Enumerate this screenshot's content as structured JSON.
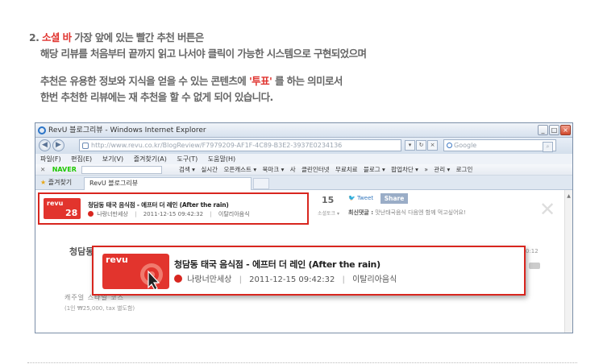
{
  "instruction": {
    "number": "2.",
    "highlight": "소셜 바",
    "line1_rest": "가장 앞에 있는 빨간 추천 버튼은",
    "line2": "해당 리뷰를 처음부터 끝까지 읽고 나서야 클릭이 가능한 시스템으로 구현되었으며",
    "line3_pre": "추천은 유용한 정보와 지식을 얻을 수 있는 콘텐츠에",
    "line3_quote": "'투표'",
    "line3_post": "를 하는 의미로서",
    "line4": "한번 추천한 리뷰에는 재 추천을 할 수 없게 되어 있습니다."
  },
  "browser": {
    "title": "RevU 블로그리뷰 - Windows Internet Explorer",
    "url": "http://www.revu.co.kr/BlogReview/F7979209-AF1F-4C89-B3E2-3937E0234136",
    "search_placeholder": "Google",
    "menu": [
      "파일(F)",
      "편집(E)",
      "보기(V)",
      "즐겨찾기(A)",
      "도구(T)",
      "도움말(H)"
    ],
    "toolbar_brand": "NAVER",
    "toolbar_items": [
      "검색 ▾",
      "실시간",
      "오픈캐스트 ▾",
      "북마크 ▾",
      "사",
      "클린인터넷",
      "무료치료",
      "블로그 ▾",
      "팝업차단 ▾",
      "»",
      "관리 ▾",
      "로그인"
    ],
    "favorites_label": "즐겨찾기",
    "tab_label": "RevU 블로그리뷰"
  },
  "social_bar": {
    "revu_label": "revu",
    "recommend_count": "28",
    "post_title": "청담동 태국 음식점 - 에프터 더 레인 (After the rain)",
    "author": "나랑너만세상",
    "date": "2011-12-15 09:42:32",
    "category": "이탈리아음식",
    "comment_count": "15",
    "comment_label": "소셜토크 ▾",
    "tweet_label": "Tweet",
    "share_label": "Share",
    "recent_label": "최신댓글 :",
    "recent_text": "맛난태국음식 다음엔 함께 먹고싶어요!"
  },
  "background": {
    "page_title": "청담동",
    "sub1": "캐주얼 스타일 코스",
    "sub2": "(1인 ₩25,000, tax 별도함)",
    "right_time": "0:12"
  },
  "zoom": {
    "revu_label": "revu",
    "post_title": "청담동 태국 음식점 - 에프터 더 레인 (After the rain)",
    "author": "나랑너만세상",
    "date": "2011-12-15 09:42:32",
    "category": "이탈리아음식"
  }
}
